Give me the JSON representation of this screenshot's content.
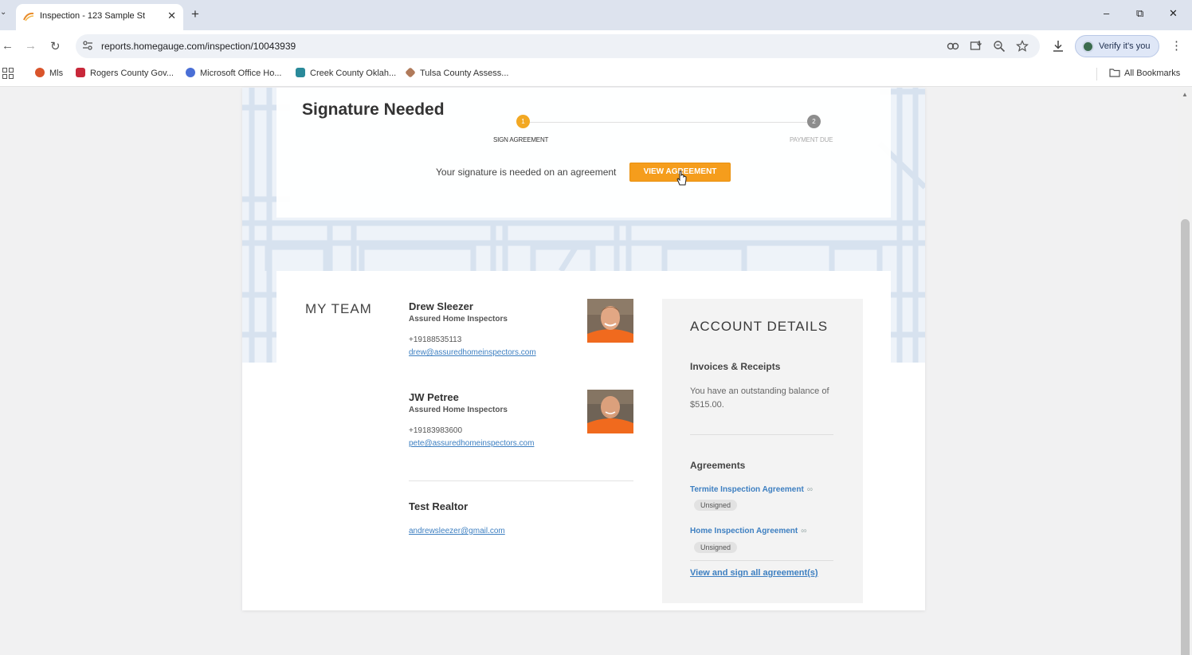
{
  "browser": {
    "tab_title": "Inspection - 123 Sample St",
    "url": "reports.homegauge.com/inspection/10043939",
    "profile_label": "Verify it's you",
    "bookmarks": [
      "Mls",
      "Rogers County Gov...",
      "Microsoft Office Ho...",
      "Creek County Oklah...",
      "Tulsa County Assess..."
    ],
    "all_bookmarks_label": "All Bookmarks"
  },
  "signature": {
    "title": "Signature Needed",
    "steps": [
      {
        "number": "1",
        "label": "SIGN AGREEMENT"
      },
      {
        "number": "2",
        "label": "PAYMENT DUE"
      }
    ],
    "message": "Your signature is needed on an agreement",
    "button_label": "VIEW AGREEMENT"
  },
  "team": {
    "heading": "MY TEAM",
    "members": [
      {
        "name": "Drew Sleezer",
        "company": "Assured Home Inspectors",
        "phone": "+19188535113",
        "email": "drew@assuredhomeinspectors.com"
      },
      {
        "name": "JW Petree",
        "company": "Assured Home Inspectors",
        "phone": "+19183983600",
        "email": "pete@assuredhomeinspectors.com"
      },
      {
        "name": "Test Realtor",
        "email": "andrewsleezer@gmail.com"
      }
    ]
  },
  "account": {
    "heading": "ACCOUNT DETAILS",
    "invoices_heading": "Invoices & Receipts",
    "balance_text": "You have an outstanding balance of $515.00.",
    "agreements_heading": "Agreements",
    "agreements": [
      {
        "name": "Termite Inspection Agreement",
        "status": "Unsigned"
      },
      {
        "name": "Home Inspection Agreement",
        "status": "Unsigned"
      }
    ],
    "view_all_label": "View and sign all agreement(s)"
  },
  "colors": {
    "accent_orange": "#f59d1c",
    "link_blue": "#3d7fc1",
    "step_inactive": "#8d8d8d"
  }
}
